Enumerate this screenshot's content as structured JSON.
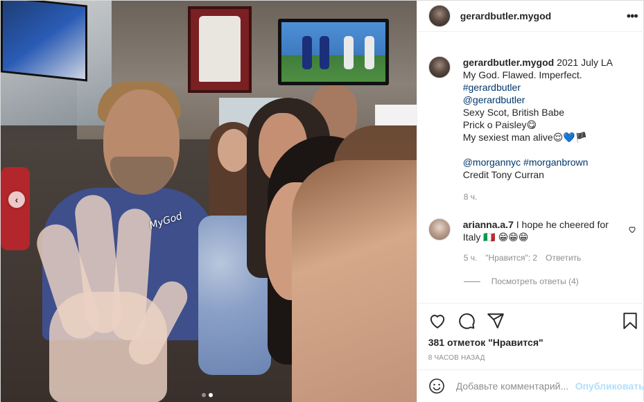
{
  "media": {
    "watermark": "MyGod",
    "prev_arrow": "‹",
    "carousel_count": 2,
    "carousel_active": 1
  },
  "header": {
    "username": "gerardbutler.mygod",
    "more_icon": "•••"
  },
  "caption": {
    "username": "gerardbutler.mygod",
    "lines": [
      "2021 July LA",
      "My God. Flawed. Imperfect.",
      "#gerardbutler",
      "@gerardbutler",
      "Sexy Scot, British Babe",
      "Prick o Paisley😋",
      "My sexiest man alive😌💙🏴",
      "",
      "@morgannyc #morganbrown",
      "Credit Tony Curran"
    ],
    "time": "8 ч."
  },
  "comment": {
    "username": "arianna.a.7",
    "text": "I hope he cheered for Italy 🇮🇹 😁😁😁",
    "time": "5 ч.",
    "likes": "\"Нравится\": 2",
    "reply": "Ответить",
    "view_replies": "Посмотреть ответы (4)"
  },
  "actions": {
    "likes": "381 отметок \"Нравится\"",
    "time_ago": "8 часов назад"
  },
  "add_comment": {
    "placeholder": "Добавьте комментарий...",
    "post": "Опубликовать"
  },
  "colors": {
    "link": "#00376b",
    "text": "#262626",
    "muted": "#8e8e8e",
    "post_disabled": "#b2dffc"
  }
}
